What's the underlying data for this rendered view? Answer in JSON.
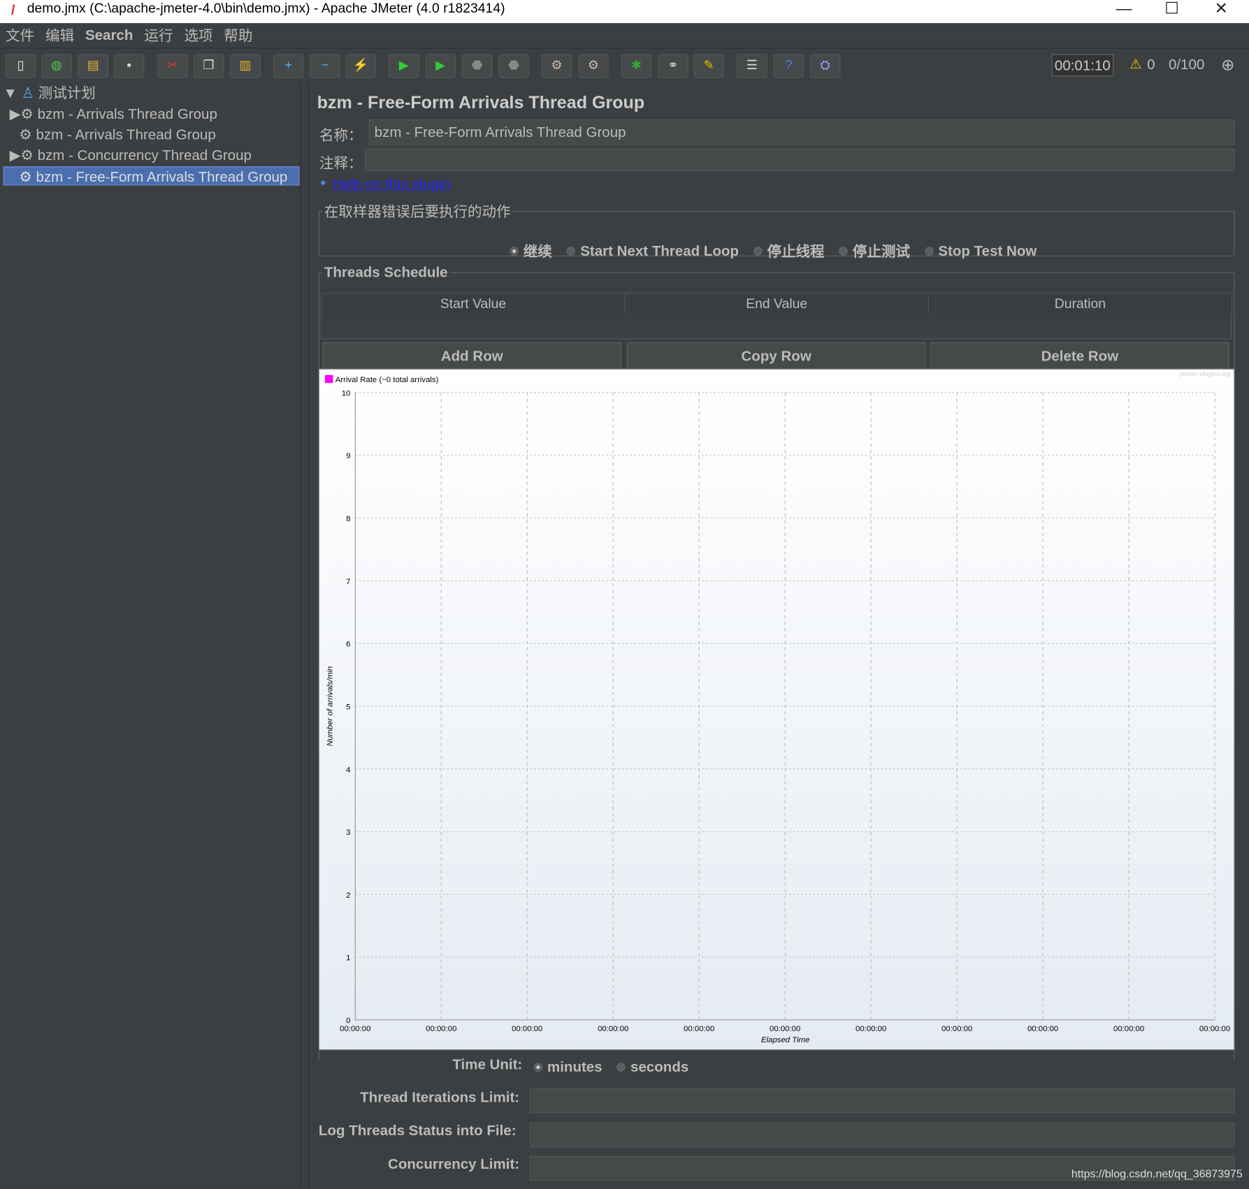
{
  "window": {
    "title": "demo.jmx (C:\\apache-jmeter-4.0\\bin\\demo.jmx) - Apache JMeter (4.0 r1823414)",
    "minimize": "—",
    "maximize": "☐",
    "close": "✕"
  },
  "menu": [
    "文件",
    "编辑",
    "Search",
    "运行",
    "选项",
    "帮助"
  ],
  "toolbar": {
    "icons": [
      "new-icon",
      "templates-icon",
      "open-icon",
      "save-icon",
      "cut-icon",
      "copy-icon",
      "paste-icon",
      "expand-icon",
      "collapse-icon",
      "toggle-icon",
      "start-icon",
      "start-no-pause-icon",
      "stop-icon",
      "shutdown-icon",
      "remote-start-icon",
      "remote-stop-icon",
      "function-helper-icon",
      "search-icon",
      "clear-all-icon",
      "log-viewer-icon",
      "help-icon",
      "remote-icon"
    ],
    "timer": "00:01:10",
    "warnings": "0",
    "threads": "0/100"
  },
  "tree": {
    "root": "测试计划",
    "items": [
      "bzm - Arrivals Thread Group",
      "bzm - Arrivals Thread Group",
      "bzm - Concurrency Thread Group",
      "bzm - Free-Form Arrivals Thread Group"
    ],
    "selected": 3
  },
  "panel": {
    "title": "bzm - Free-Form Arrivals Thread Group",
    "name_label": "名称：",
    "name_value": "bzm - Free-Form Arrivals Thread Group",
    "comment_label": "注释：",
    "comment_value": "",
    "help_link": "Help on this plugin",
    "action_legend": "在取样器错误后要执行的动作",
    "actions": [
      "继续",
      "Start Next Thread Loop",
      "停止线程",
      "停止测试",
      "Stop Test Now"
    ],
    "action_selected": 0,
    "schedule_legend": "Threads Schedule",
    "columns": [
      "Start Value",
      "End Value",
      "Duration"
    ],
    "buttons": [
      "Add Row",
      "Copy Row",
      "Delete Row"
    ],
    "time_unit_label": "Time Unit:",
    "time_units": [
      "minutes",
      "seconds"
    ],
    "time_unit_selected": 0,
    "iterations_label": "Thread Iterations Limit:",
    "iterations_value": "",
    "log_label": "Log Threads Status into File:",
    "log_value": "",
    "concurrency_label": "Concurrency Limit:",
    "concurrency_value": ""
  },
  "chart_data": {
    "type": "line",
    "legend": "Arrival Rate (~0 total arrivals)",
    "legend_color": "#ff00ff",
    "watermark": "jmeter-plugins.org",
    "xlabel": "Elapsed Time",
    "ylabel": "Number of arrivals/min",
    "ylim": [
      0,
      10
    ],
    "yticks": [
      "0",
      "1",
      "2",
      "3",
      "4",
      "5",
      "6",
      "7",
      "8",
      "9",
      "10"
    ],
    "xticks": [
      "00:00:00",
      "00:00:00",
      "00:00:00",
      "00:00:00",
      "00:00:00",
      "00:00:00",
      "00:00:00",
      "00:00:00",
      "00:00:00",
      "00:00:00",
      "00:00:00"
    ],
    "grid": true,
    "series": [
      {
        "name": "Arrival Rate (~0 total arrivals)",
        "values": []
      }
    ]
  },
  "watermark": "https://blog.csdn.net/qq_36873975"
}
